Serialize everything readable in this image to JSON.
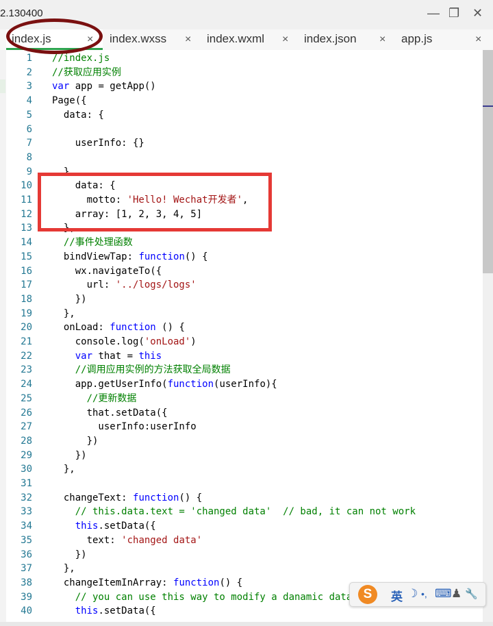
{
  "window": {
    "version": "2.130400",
    "minimize": "—",
    "restore": "❐",
    "close": "✕"
  },
  "tabs": [
    {
      "label": "index.js",
      "close": "×",
      "active": true
    },
    {
      "label": "index.wxss",
      "close": "×"
    },
    {
      "label": "index.wxml",
      "close": "×"
    },
    {
      "label": "index.json",
      "close": "×"
    },
    {
      "label": "app.js",
      "close": "×"
    }
  ],
  "editor": {
    "lines": [
      {
        "n": "1",
        "tokens": [
          [
            "cm",
            "//index.js"
          ]
        ]
      },
      {
        "n": "2",
        "tokens": [
          [
            "cm",
            "//获取应用实例"
          ]
        ]
      },
      {
        "n": "3",
        "tokens": [
          [
            "kw",
            "var"
          ],
          [
            "",
            " app = getApp()"
          ]
        ]
      },
      {
        "n": "4",
        "tokens": [
          [
            "",
            "Page({"
          ]
        ]
      },
      {
        "n": "5",
        "tokens": [
          [
            "",
            "  data: {"
          ]
        ]
      },
      {
        "n": "6",
        "tokens": [
          [
            "",
            ""
          ]
        ]
      },
      {
        "n": "7",
        "tokens": [
          [
            "",
            "    userInfo: {}"
          ]
        ]
      },
      {
        "n": "8",
        "tokens": [
          [
            "",
            ""
          ]
        ]
      },
      {
        "n": "9",
        "tokens": [
          [
            "",
            "  },"
          ]
        ]
      },
      {
        "n": "10",
        "tokens": [
          [
            "",
            "    data: {"
          ]
        ]
      },
      {
        "n": "11",
        "tokens": [
          [
            "",
            "      motto: "
          ],
          [
            "str",
            "'Hello! Wechat开发者'"
          ],
          [
            "",
            ","
          ]
        ]
      },
      {
        "n": "12",
        "tokens": [
          [
            "",
            "    array: [1, 2, 3, 4, 5]"
          ]
        ]
      },
      {
        "n": "13",
        "tokens": [
          [
            "",
            "  },"
          ]
        ]
      },
      {
        "n": "14",
        "tokens": [
          [
            "cm",
            "  //事件处理函数"
          ]
        ]
      },
      {
        "n": "15",
        "tokens": [
          [
            "",
            "  bindViewTap: "
          ],
          [
            "kw",
            "function"
          ],
          [
            "",
            "() {"
          ]
        ]
      },
      {
        "n": "16",
        "tokens": [
          [
            "",
            "    wx.navigateTo({"
          ]
        ]
      },
      {
        "n": "17",
        "tokens": [
          [
            "",
            "      url: "
          ],
          [
            "str",
            "'../logs/logs'"
          ]
        ]
      },
      {
        "n": "18",
        "tokens": [
          [
            "",
            "    })"
          ]
        ]
      },
      {
        "n": "19",
        "tokens": [
          [
            "",
            "  },"
          ]
        ]
      },
      {
        "n": "20",
        "tokens": [
          [
            "",
            "  onLoad: "
          ],
          [
            "kw",
            "function"
          ],
          [
            "",
            " () {"
          ]
        ]
      },
      {
        "n": "21",
        "tokens": [
          [
            "",
            "    console.log("
          ],
          [
            "str",
            "'onLoad'"
          ],
          [
            "",
            ")"
          ]
        ]
      },
      {
        "n": "22",
        "tokens": [
          [
            "kw",
            "    var"
          ],
          [
            "",
            " that = "
          ],
          [
            "kw",
            "this"
          ]
        ]
      },
      {
        "n": "23",
        "tokens": [
          [
            "cm",
            "    //调用应用实例的方法获取全局数据"
          ]
        ]
      },
      {
        "n": "24",
        "tokens": [
          [
            "",
            "    app.getUserInfo("
          ],
          [
            "kw",
            "function"
          ],
          [
            "",
            "(userInfo){"
          ]
        ]
      },
      {
        "n": "25",
        "tokens": [
          [
            "cm",
            "      //更新数据"
          ]
        ]
      },
      {
        "n": "26",
        "tokens": [
          [
            "",
            "      that.setData({"
          ]
        ]
      },
      {
        "n": "27",
        "tokens": [
          [
            "",
            "        userInfo:userInfo"
          ]
        ]
      },
      {
        "n": "28",
        "tokens": [
          [
            "",
            "      })"
          ]
        ]
      },
      {
        "n": "29",
        "tokens": [
          [
            "",
            "    })"
          ]
        ]
      },
      {
        "n": "30",
        "tokens": [
          [
            "",
            "  },"
          ]
        ]
      },
      {
        "n": "31",
        "tokens": [
          [
            "",
            ""
          ]
        ]
      },
      {
        "n": "32",
        "tokens": [
          [
            "",
            "  changeText: "
          ],
          [
            "kw",
            "function"
          ],
          [
            "",
            "() {"
          ]
        ]
      },
      {
        "n": "33",
        "tokens": [
          [
            "cm",
            "    // this.data.text = 'changed data'  // bad, it can not work"
          ]
        ]
      },
      {
        "n": "34",
        "tokens": [
          [
            "kw",
            "    this"
          ],
          [
            "",
            ".setData({"
          ]
        ]
      },
      {
        "n": "35",
        "tokens": [
          [
            "",
            "      text: "
          ],
          [
            "str",
            "'changed data'"
          ]
        ]
      },
      {
        "n": "36",
        "tokens": [
          [
            "",
            "    })"
          ]
        ]
      },
      {
        "n": "37",
        "tokens": [
          [
            "",
            "  },"
          ]
        ]
      },
      {
        "n": "38",
        "tokens": [
          [
            "",
            "  changeItemInArray: "
          ],
          [
            "kw",
            "function"
          ],
          [
            "",
            "() {"
          ]
        ]
      },
      {
        "n": "39",
        "tokens": [
          [
            "cm",
            "    // you can use this way to modify a danamic data"
          ]
        ]
      },
      {
        "n": "40",
        "tokens": [
          [
            "kw",
            "    this"
          ],
          [
            "",
            ".setData({"
          ]
        ]
      }
    ]
  },
  "ime": {
    "logo": "S",
    "mode": "英",
    "moon": "☽",
    "punct": "•,",
    "keyboard": "⌨",
    "user": "♟",
    "tool": "🔧"
  },
  "colors": {
    "keyword": "#0000ff",
    "string": "#a31515",
    "comment": "#008000",
    "line_number": "#237893",
    "highlight_rect": "#e53935",
    "highlight_circle": "#7a1010",
    "active_tab_underline": "#2ea44f"
  }
}
